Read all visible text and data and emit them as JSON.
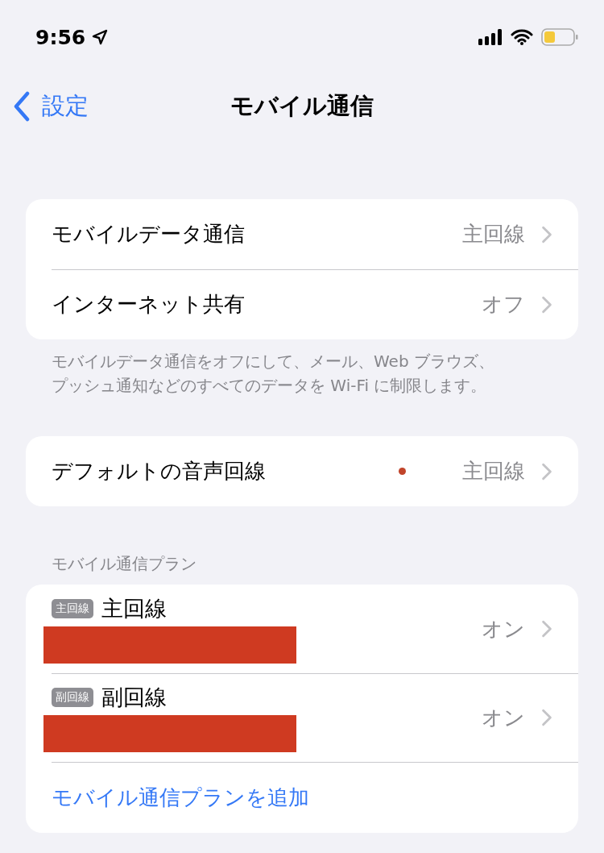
{
  "status_bar": {
    "time": "9:56"
  },
  "nav": {
    "back": "設定",
    "title": "モバイル通信"
  },
  "group1": {
    "rows": [
      {
        "label": "モバイルデータ通信",
        "value": "主回線"
      },
      {
        "label": "インターネット共有",
        "value": "オフ"
      }
    ],
    "footer": "モバイルデータ通信をオフにして、メール、Web ブラウズ、プッシュ通知などのすべてのデータを Wi-Fi に制限します。"
  },
  "group2": {
    "rows": [
      {
        "label": "デフォルトの音声回線",
        "value": "主回線"
      }
    ]
  },
  "plans": {
    "header": "モバイル通信プラン",
    "rows": [
      {
        "badge": "主回線",
        "label": "主回線",
        "value": "オン"
      },
      {
        "badge": "副回線",
        "label": "副回線",
        "value": "オン"
      }
    ],
    "add": "モバイル通信プランを追加"
  }
}
